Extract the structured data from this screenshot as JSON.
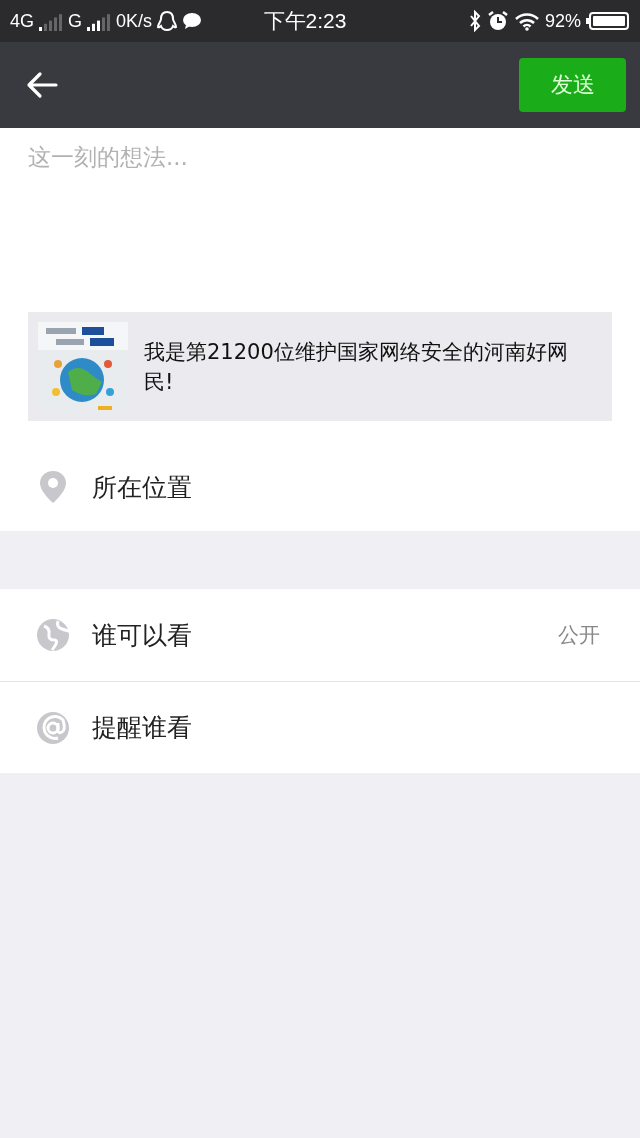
{
  "status_bar": {
    "network_1": "4G",
    "network_2": "G",
    "speed": "0K/s",
    "time": "下午2:23",
    "battery": "92%"
  },
  "nav": {
    "send_button": "发送"
  },
  "composer": {
    "placeholder": "这一刻的想法..."
  },
  "link_card": {
    "text": "我是第21200位维护国家网络安全的河南好网民!"
  },
  "sections": [
    {
      "rows": [
        {
          "kind": "location",
          "label": "所在位置"
        }
      ]
    },
    {
      "rows": [
        {
          "kind": "visibility",
          "label": "谁可以看",
          "value": "公开"
        },
        {
          "kind": "mention",
          "label": "提醒谁看"
        }
      ]
    }
  ]
}
